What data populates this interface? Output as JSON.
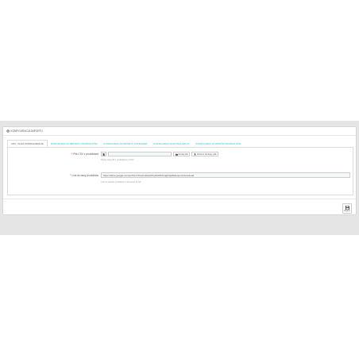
{
  "panel": {
    "title": "Konfiguracja importu"
  },
  "tabs": [
    {
      "label": "CSV / XLSX konfiguracja",
      "active": true
    },
    {
      "label": "Konfiguracja importu produktów",
      "active": false
    },
    {
      "label": "Konfiguracja importu kategorii",
      "active": false
    },
    {
      "label": "Konfiguracja aktualizacji",
      "active": false
    },
    {
      "label": "Konfiguracja opisów produktów",
      "active": false
    }
  ],
  "form": {
    "file_label": "Plik CSV z produktami",
    "choose_file_label": "Dodaj plik",
    "download_file_label": "Pobierz bieżący plik",
    "file_help": "Wgraj swój plik z produktami w CSV",
    "link_label": "Link do bazy produktów",
    "link_value": "https://drive.google.com/uc?id=1ThvAcoRvHrPhy0cbWXLdgFhql2b&export=download",
    "link_help": "Link do swoich produktów w formacie XLSX"
  },
  "footer": {
    "save_label": "Zapisz"
  },
  "colors": {
    "accent": "#25b9d7",
    "required": "#e50b70",
    "background": "#e5e5e5"
  }
}
